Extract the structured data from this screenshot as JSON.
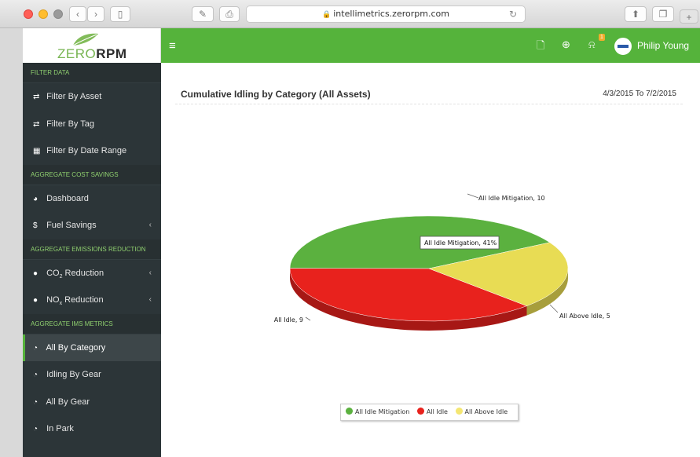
{
  "browser": {
    "url": "intellimetrics.zerorpm.com"
  },
  "app": {
    "logo": {
      "part1": "ZERO",
      "part2": "RPM"
    },
    "user": {
      "name": "Philip Young"
    },
    "notification_count": "1"
  },
  "sidebar": {
    "sections": [
      {
        "header": "FILTER DATA",
        "items": [
          {
            "label": "Filter By Asset",
            "icon": "retweet-icon"
          },
          {
            "label": "Filter By Tag",
            "icon": "retweet-icon"
          },
          {
            "label": "Filter By Date Range",
            "icon": "calendar-icon"
          }
        ]
      },
      {
        "header": "AGGREGATE COST SAVINGS",
        "items": [
          {
            "label": "Dashboard",
            "icon": "dashboard-icon"
          },
          {
            "label": "Fuel Savings",
            "icon": "dollar-icon",
            "has_chevron": true
          }
        ]
      },
      {
        "header": "AGGREGATE EMISSIONS REDUCTION",
        "items": [
          {
            "label_main": "CO",
            "label_sub": "2",
            "label_rest": " Reduction",
            "icon": "globe-icon",
            "has_chevron": true
          },
          {
            "label_main": "NO",
            "label_sub": "x",
            "label_rest": " Reduction",
            "icon": "globe-icon",
            "has_chevron": true
          }
        ]
      },
      {
        "header": "AGGREGATE IMS METRICS",
        "items": [
          {
            "label": "All By Category",
            "icon": "pie-chart-icon",
            "active": true
          },
          {
            "label": "Idling By Gear",
            "icon": "pie-chart-icon"
          },
          {
            "label": "All By Gear",
            "icon": "pie-chart-icon"
          },
          {
            "label": "In Park",
            "icon": "pie-chart-icon"
          }
        ]
      }
    ]
  },
  "main": {
    "title": "Cumulative Idling by Category (All Assets)",
    "date_range": "4/3/2015 To 7/2/2015",
    "tooltip": "All Idle Mitigation, 41%"
  },
  "chart_data": {
    "type": "pie",
    "title": "",
    "slices": [
      {
        "label": "All Idle Mitigation",
        "value": 10,
        "data_label": "All Idle Mitigation, 10",
        "color": "#5bb13f"
      },
      {
        "label": "All Idle",
        "value": 9,
        "data_label": "All Idle, 9",
        "color": "#e8221d"
      },
      {
        "label": "All Above Idle",
        "value": 5,
        "data_label": "All Above Idle, 5",
        "color": "#e8dc54"
      }
    ],
    "legend": [
      "All Idle Mitigation",
      "All Idle",
      "All Above Idle"
    ],
    "legend_position": "bottom-center",
    "style": "3d"
  },
  "colors": {
    "brand_green": "#55b33b",
    "sidebar_bg": "#2c3538",
    "sidebar_header_text": "#8fcf6f"
  }
}
